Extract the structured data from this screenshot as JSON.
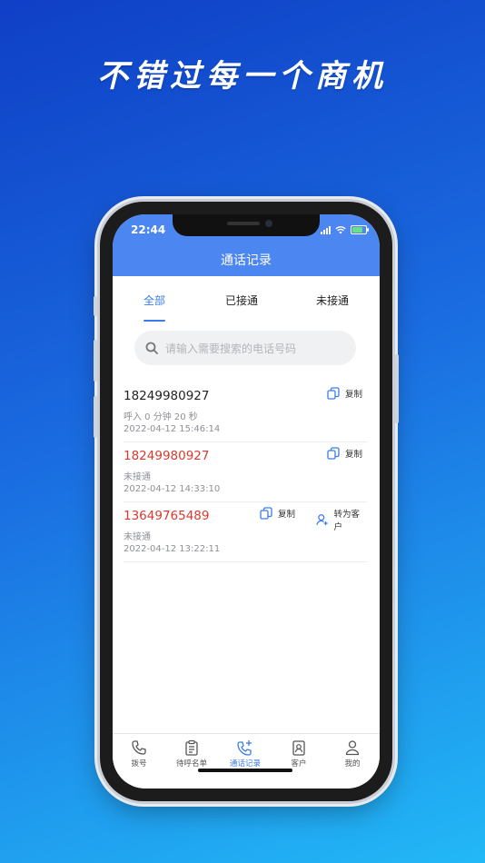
{
  "headline": "不错过每一个商机",
  "status": {
    "time": "22:44"
  },
  "nav": {
    "title": "通话记录"
  },
  "tabs": [
    "全部",
    "已接通",
    "未接通"
  ],
  "search": {
    "placeholder": "请输入需要搜索的电话号码"
  },
  "records": [
    {
      "number": "18249980927",
      "desc": "呼入 0 分钟 20 秒",
      "time": "2022-04-12 15:46:14",
      "missed": false,
      "copy": "复制"
    },
    {
      "number": "18249980927",
      "desc": "未接通",
      "time": "2022-04-12 14:33:10",
      "missed": true,
      "copy": "复制"
    },
    {
      "number": "13649765489",
      "desc": "未接通",
      "time": "2022-04-12 13:22:11",
      "missed": true,
      "copy": "复制",
      "convert": "转为客户"
    }
  ],
  "tabbar": [
    "拨号",
    "待呼名单",
    "通话记录",
    "客户",
    "我的"
  ],
  "colors": {
    "accent": "#3b7de8",
    "header": "#4c86f0",
    "missed": "#d83a2f"
  }
}
